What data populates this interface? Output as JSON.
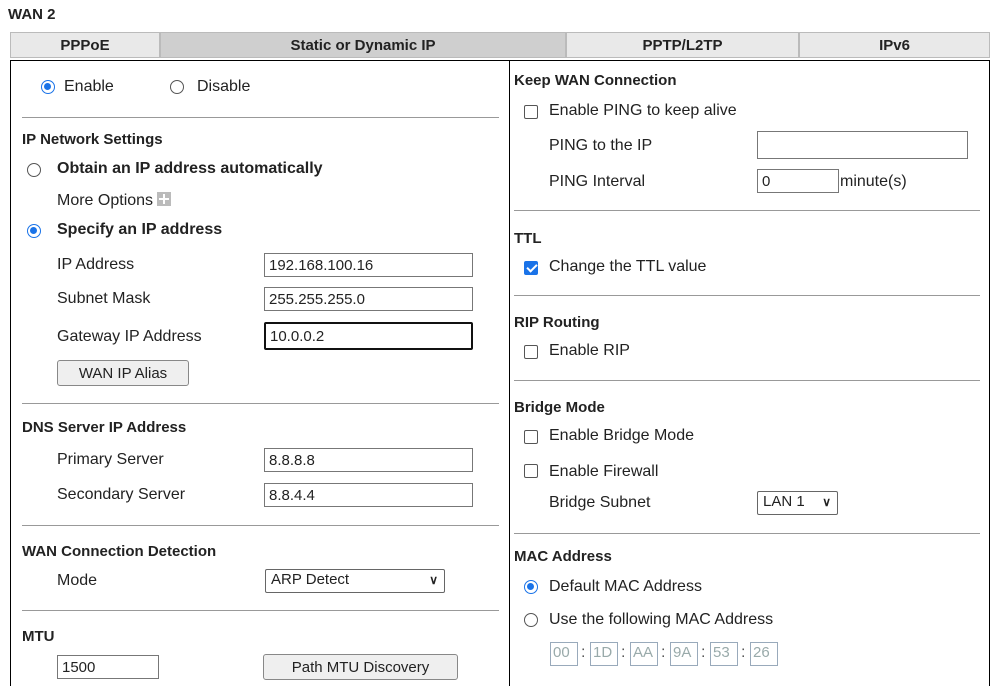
{
  "title": "WAN 2",
  "tabs": [
    "PPPoE",
    "Static or Dynamic IP",
    "PPTP/L2TP",
    "IPv6"
  ],
  "enable": {
    "enable_label": "Enable",
    "disable_label": "Disable"
  },
  "ip_network": {
    "heading": "IP Network Settings",
    "obtain_label": "Obtain an IP address automatically",
    "more_options": "More Options",
    "specify_label": "Specify an IP address",
    "ip_address_label": "IP Address",
    "ip_address": "192.168.100.16",
    "subnet_label": "Subnet Mask",
    "subnet": "255.255.255.0",
    "gateway_label": "Gateway IP Address",
    "gateway": "10.0.0.2",
    "alias_button": "WAN IP Alias"
  },
  "dns": {
    "heading": "DNS Server IP Address",
    "primary_label": "Primary Server",
    "primary": "8.8.8.8",
    "secondary_label": "Secondary Server",
    "secondary": "8.8.4.4"
  },
  "detection": {
    "heading": "WAN Connection Detection",
    "mode_label": "Mode",
    "mode": "ARP Detect"
  },
  "mtu": {
    "heading": "MTU",
    "value": "1500",
    "discovery_button": "Path MTU Discovery"
  },
  "keep": {
    "heading": "Keep WAN Connection",
    "ping_enable": "Enable PING to keep alive",
    "ping_ip_label": "PING to the IP",
    "ping_ip": "",
    "interval_label": "PING Interval",
    "interval": "0",
    "interval_unit": "minute(s)"
  },
  "ttl": {
    "heading": "TTL",
    "change_label": "Change the TTL value"
  },
  "rip": {
    "heading": "RIP Routing",
    "enable_label": "Enable RIP"
  },
  "bridge": {
    "heading": "Bridge Mode",
    "enable_label": "Enable Bridge Mode",
    "firewall_label": "Enable Firewall",
    "subnet_label": "Bridge Subnet",
    "subnet": "LAN 1"
  },
  "mac": {
    "heading": "MAC Address",
    "default_label": "Default MAC Address",
    "custom_label": "Use the following MAC Address",
    "octets": [
      "00",
      "1D",
      "AA",
      "9A",
      "53",
      "26"
    ]
  }
}
